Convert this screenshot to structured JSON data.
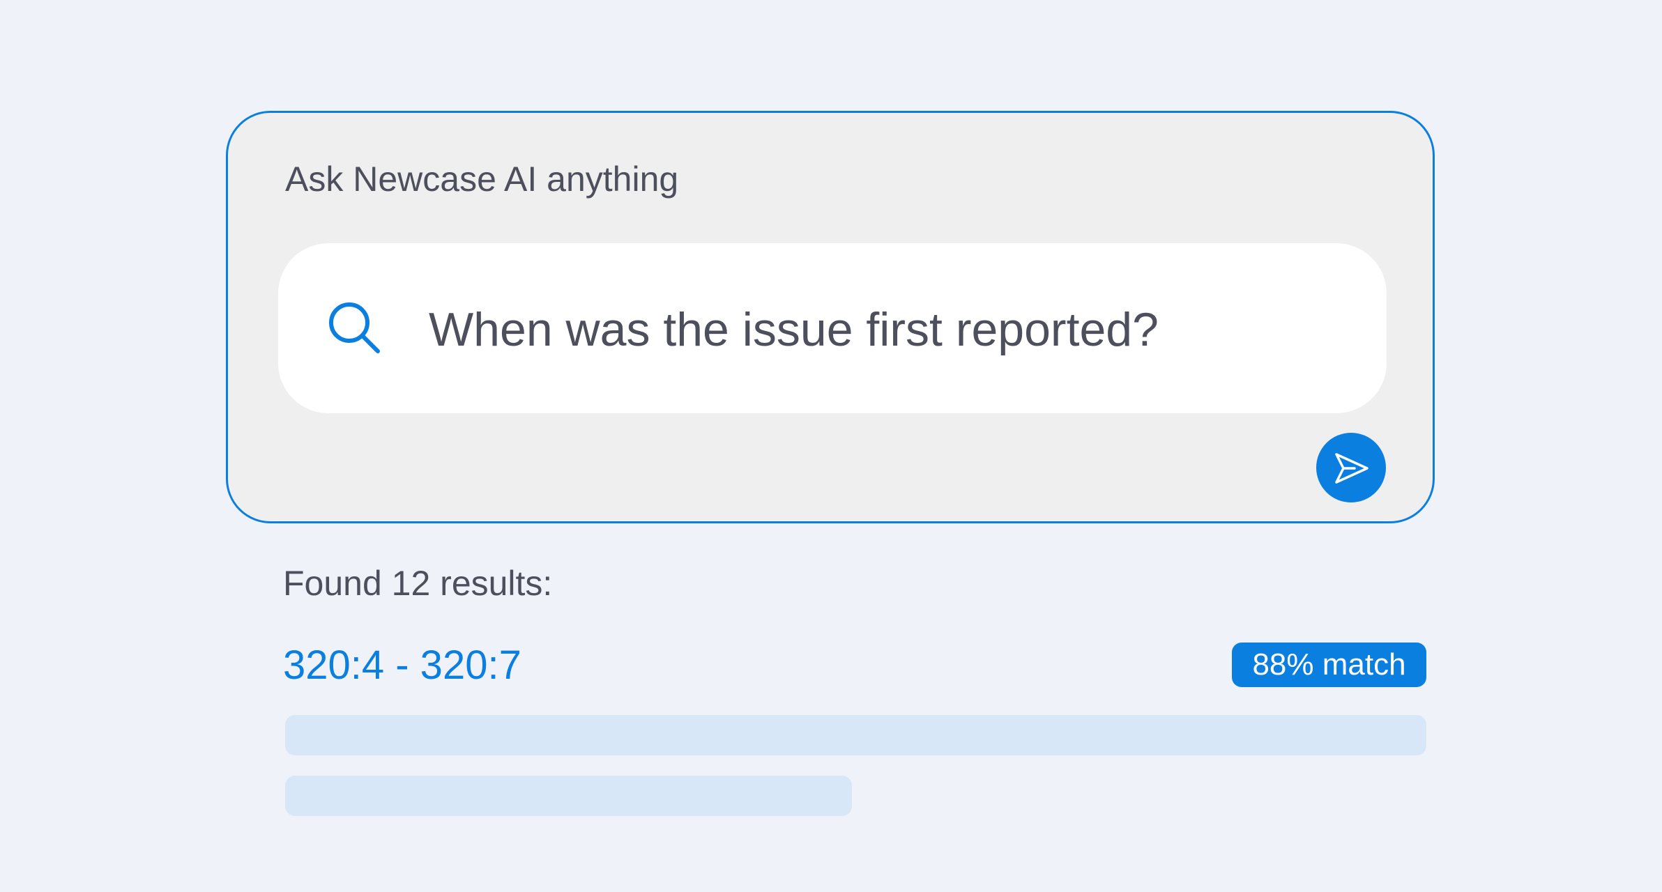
{
  "ask": {
    "prompt": "Ask Newcase AI anything",
    "query": "When was the issue first reported?",
    "search_icon": "search-icon",
    "send_icon": "send-icon"
  },
  "results": {
    "count_text": "Found 12 results:",
    "items": [
      {
        "range": "320:4 - 320:7",
        "match": "88% match"
      }
    ]
  },
  "colors": {
    "accent": "#0B7FE0",
    "page_background": "#F0F2F9",
    "panel_background": "#EFEFEF",
    "text": "#4E4F5C",
    "skeleton": "#D8E7F7"
  }
}
